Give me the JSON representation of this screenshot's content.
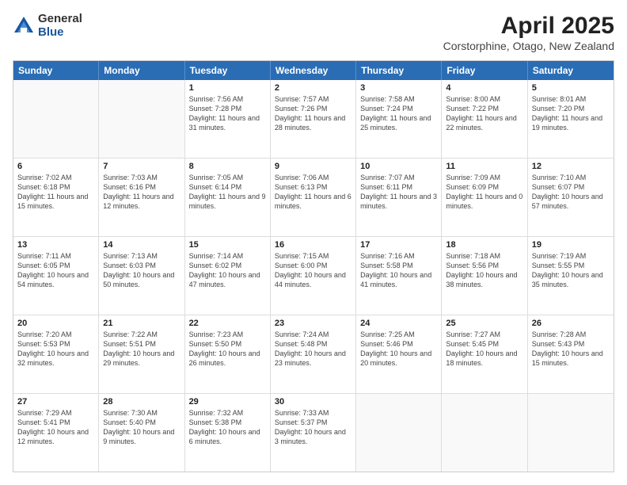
{
  "logo": {
    "general": "General",
    "blue": "Blue"
  },
  "title": "April 2025",
  "subtitle": "Corstorphine, Otago, New Zealand",
  "header_days": [
    "Sunday",
    "Monday",
    "Tuesday",
    "Wednesday",
    "Thursday",
    "Friday",
    "Saturday"
  ],
  "rows": [
    [
      {
        "day": "",
        "info": "",
        "empty": true
      },
      {
        "day": "",
        "info": "",
        "empty": true
      },
      {
        "day": "1",
        "info": "Sunrise: 7:56 AM\nSunset: 7:28 PM\nDaylight: 11 hours and 31 minutes.",
        "empty": false
      },
      {
        "day": "2",
        "info": "Sunrise: 7:57 AM\nSunset: 7:26 PM\nDaylight: 11 hours and 28 minutes.",
        "empty": false
      },
      {
        "day": "3",
        "info": "Sunrise: 7:58 AM\nSunset: 7:24 PM\nDaylight: 11 hours and 25 minutes.",
        "empty": false
      },
      {
        "day": "4",
        "info": "Sunrise: 8:00 AM\nSunset: 7:22 PM\nDaylight: 11 hours and 22 minutes.",
        "empty": false
      },
      {
        "day": "5",
        "info": "Sunrise: 8:01 AM\nSunset: 7:20 PM\nDaylight: 11 hours and 19 minutes.",
        "empty": false
      }
    ],
    [
      {
        "day": "6",
        "info": "Sunrise: 7:02 AM\nSunset: 6:18 PM\nDaylight: 11 hours and 15 minutes.",
        "empty": false
      },
      {
        "day": "7",
        "info": "Sunrise: 7:03 AM\nSunset: 6:16 PM\nDaylight: 11 hours and 12 minutes.",
        "empty": false
      },
      {
        "day": "8",
        "info": "Sunrise: 7:05 AM\nSunset: 6:14 PM\nDaylight: 11 hours and 9 minutes.",
        "empty": false
      },
      {
        "day": "9",
        "info": "Sunrise: 7:06 AM\nSunset: 6:13 PM\nDaylight: 11 hours and 6 minutes.",
        "empty": false
      },
      {
        "day": "10",
        "info": "Sunrise: 7:07 AM\nSunset: 6:11 PM\nDaylight: 11 hours and 3 minutes.",
        "empty": false
      },
      {
        "day": "11",
        "info": "Sunrise: 7:09 AM\nSunset: 6:09 PM\nDaylight: 11 hours and 0 minutes.",
        "empty": false
      },
      {
        "day": "12",
        "info": "Sunrise: 7:10 AM\nSunset: 6:07 PM\nDaylight: 10 hours and 57 minutes.",
        "empty": false
      }
    ],
    [
      {
        "day": "13",
        "info": "Sunrise: 7:11 AM\nSunset: 6:05 PM\nDaylight: 10 hours and 54 minutes.",
        "empty": false
      },
      {
        "day": "14",
        "info": "Sunrise: 7:13 AM\nSunset: 6:03 PM\nDaylight: 10 hours and 50 minutes.",
        "empty": false
      },
      {
        "day": "15",
        "info": "Sunrise: 7:14 AM\nSunset: 6:02 PM\nDaylight: 10 hours and 47 minutes.",
        "empty": false
      },
      {
        "day": "16",
        "info": "Sunrise: 7:15 AM\nSunset: 6:00 PM\nDaylight: 10 hours and 44 minutes.",
        "empty": false
      },
      {
        "day": "17",
        "info": "Sunrise: 7:16 AM\nSunset: 5:58 PM\nDaylight: 10 hours and 41 minutes.",
        "empty": false
      },
      {
        "day": "18",
        "info": "Sunrise: 7:18 AM\nSunset: 5:56 PM\nDaylight: 10 hours and 38 minutes.",
        "empty": false
      },
      {
        "day": "19",
        "info": "Sunrise: 7:19 AM\nSunset: 5:55 PM\nDaylight: 10 hours and 35 minutes.",
        "empty": false
      }
    ],
    [
      {
        "day": "20",
        "info": "Sunrise: 7:20 AM\nSunset: 5:53 PM\nDaylight: 10 hours and 32 minutes.",
        "empty": false
      },
      {
        "day": "21",
        "info": "Sunrise: 7:22 AM\nSunset: 5:51 PM\nDaylight: 10 hours and 29 minutes.",
        "empty": false
      },
      {
        "day": "22",
        "info": "Sunrise: 7:23 AM\nSunset: 5:50 PM\nDaylight: 10 hours and 26 minutes.",
        "empty": false
      },
      {
        "day": "23",
        "info": "Sunrise: 7:24 AM\nSunset: 5:48 PM\nDaylight: 10 hours and 23 minutes.",
        "empty": false
      },
      {
        "day": "24",
        "info": "Sunrise: 7:25 AM\nSunset: 5:46 PM\nDaylight: 10 hours and 20 minutes.",
        "empty": false
      },
      {
        "day": "25",
        "info": "Sunrise: 7:27 AM\nSunset: 5:45 PM\nDaylight: 10 hours and 18 minutes.",
        "empty": false
      },
      {
        "day": "26",
        "info": "Sunrise: 7:28 AM\nSunset: 5:43 PM\nDaylight: 10 hours and 15 minutes.",
        "empty": false
      }
    ],
    [
      {
        "day": "27",
        "info": "Sunrise: 7:29 AM\nSunset: 5:41 PM\nDaylight: 10 hours and 12 minutes.",
        "empty": false
      },
      {
        "day": "28",
        "info": "Sunrise: 7:30 AM\nSunset: 5:40 PM\nDaylight: 10 hours and 9 minutes.",
        "empty": false
      },
      {
        "day": "29",
        "info": "Sunrise: 7:32 AM\nSunset: 5:38 PM\nDaylight: 10 hours and 6 minutes.",
        "empty": false
      },
      {
        "day": "30",
        "info": "Sunrise: 7:33 AM\nSunset: 5:37 PM\nDaylight: 10 hours and 3 minutes.",
        "empty": false
      },
      {
        "day": "",
        "info": "",
        "empty": true
      },
      {
        "day": "",
        "info": "",
        "empty": true
      },
      {
        "day": "",
        "info": "",
        "empty": true
      }
    ]
  ]
}
